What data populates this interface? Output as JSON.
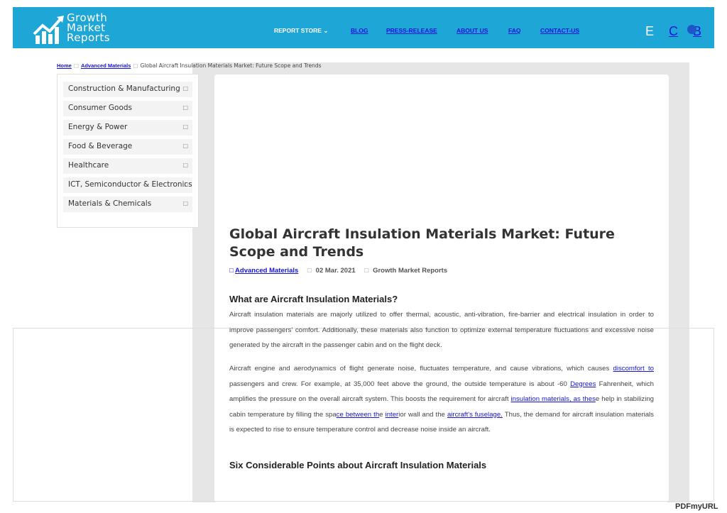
{
  "logo": {
    "line1": "Growth",
    "line2": "Market",
    "line3": "Reports"
  },
  "nav": {
    "report_store": "REPORT STORE",
    "blog": "BLOG",
    "press_release": "PRESS-RELEASE",
    "about_us": "ABOUT US",
    "faq": "FAQ",
    "contact_us": "CONTACT-US"
  },
  "util": {
    "e": "E",
    "c": "C",
    "b": "B"
  },
  "breadcrumb": {
    "home": "Home",
    "category": "Advanced Materials",
    "current": "Global Aircraft Insulation Materials Market: Future Scope and Trends"
  },
  "sidebar": {
    "items": [
      {
        "label": "Construction & Manufacturing"
      },
      {
        "label": "Consumer Goods"
      },
      {
        "label": "Energy & Power"
      },
      {
        "label": "Food & Beverage"
      },
      {
        "label": "Healthcare"
      },
      {
        "label": "ICT, Semiconductor & Electronics"
      },
      {
        "label": "Materials & Chemicals"
      }
    ]
  },
  "article": {
    "title": "Global Aircraft Insulation Materials Market: Future Scope and Trends",
    "category": "Advanced Materials",
    "date": "02 Mar. 2021",
    "author": "Growth Market Reports",
    "h1": "What are Aircraft Insulation Materials?",
    "p1": "Aircraft insulation materials are majorly utilized to offer thermal, acoustic, anti-vibration, fire-barrier and electrical insulation in order to improve passengers' comfort. Additionally, these materials also function to optimize external temperature fluctuations and excessive noise generated by the aircraft in the passenger cabin and on the flight deck.",
    "p2_a": "Aircraft engine and aerodynamics of flight generate noise, fluctuates temperature, and cause vibrations, which causes ",
    "p2_link1": "discomfort to",
    "p2_b": " passengers and crew. For example, at 35,000 feet above the ground, the outside temperature is about -60 ",
    "p2_link2": "Degrees",
    "p2_c": " Fahrenheit, which amplifies the pressure on the overall aircraft system. This boosts the requirement for aircraft ",
    "p2_link3": "insulation materials, as thes",
    "p2_d": "e help in stabilizing cabin temperature by filling the spa",
    "p2_link4": "ce between th",
    "p2_e": "e ",
    "p2_link5": "inter",
    "p2_f": "ior wall and the ",
    "p2_link6": "aircraft's fuselage.",
    "p2_g": " Thus, the demand for aircraft insulation materials is expected to rise to ensure temperature control and  decrease noise inside an aircraft.",
    "h2": "Six Considerable Points about Aircraft Insulation Materials"
  },
  "footer": {
    "pdf": "PDFmyURL"
  },
  "colors": {
    "header": "#1ea7d6",
    "link": "#1515d8",
    "panel": "#e6e6e6"
  }
}
